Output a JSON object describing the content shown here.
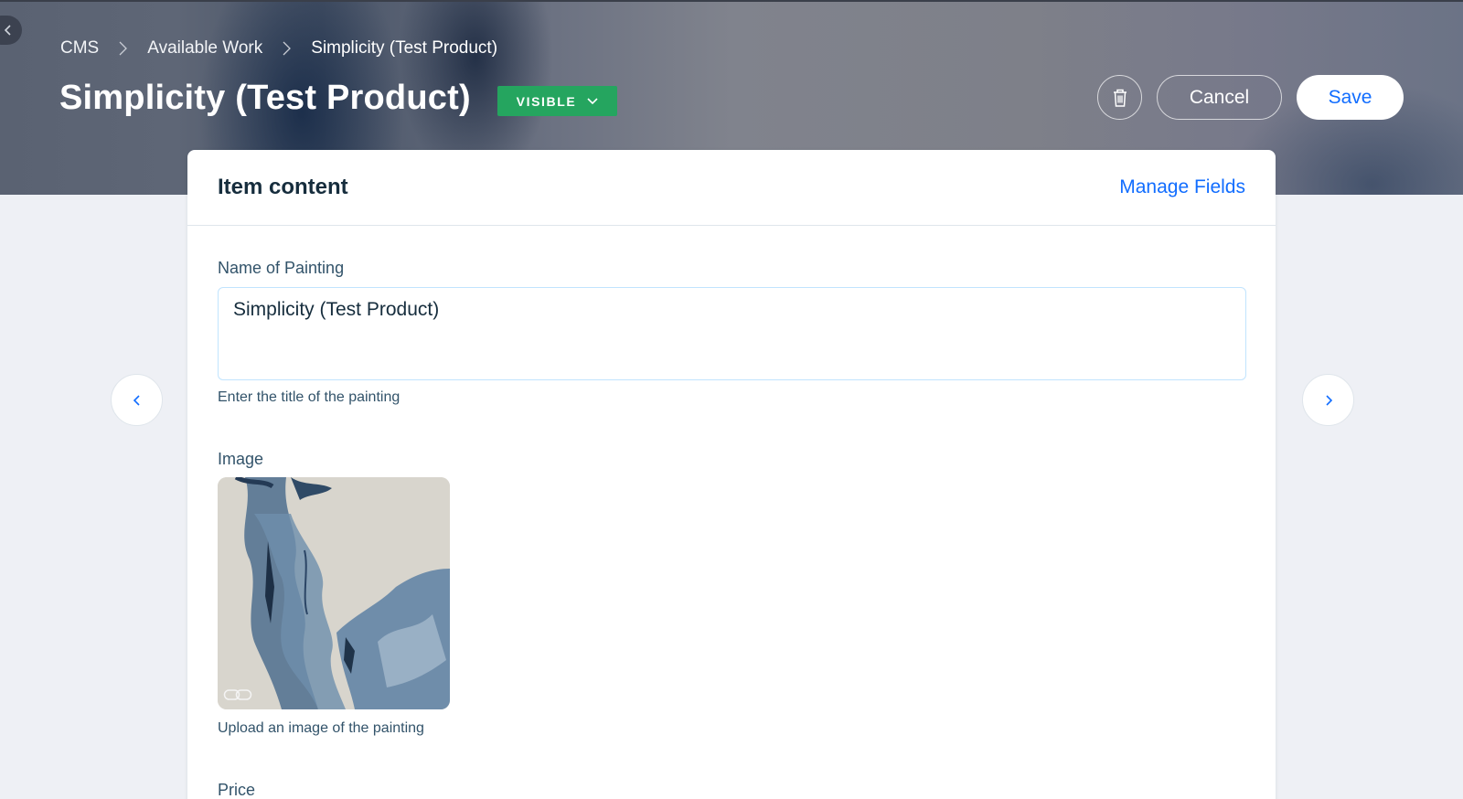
{
  "header": {
    "breadcrumb": [
      "CMS",
      "Available Work",
      "Simplicity (Test Product)"
    ],
    "title": "Simplicity (Test Product)",
    "visibility": "VISIBLE",
    "cancel_label": "Cancel",
    "save_label": "Save"
  },
  "card": {
    "title": "Item content",
    "manage_fields_label": "Manage Fields",
    "fields": {
      "name": {
        "label": "Name of Painting",
        "value": "Simplicity (Test Product)",
        "helper": "Enter the title of the painting"
      },
      "image": {
        "label": "Image",
        "helper": "Upload an image of the painting"
      },
      "price": {
        "label": "Price"
      }
    }
  },
  "icons": {
    "collapse": "chevron-left-icon",
    "breadcrumb_separator": "chevron-right-icon",
    "visibility_dropdown": "chevron-down-icon",
    "delete": "trash-icon",
    "image_link": "link-icon",
    "prev": "chevron-left-icon",
    "next": "chevron-right-icon"
  },
  "colors": {
    "accent": "#116dff",
    "visible_badge": "#25a55f",
    "text_primary": "#162d3d",
    "text_secondary": "#32536a",
    "page_bg": "#eef0f5"
  }
}
